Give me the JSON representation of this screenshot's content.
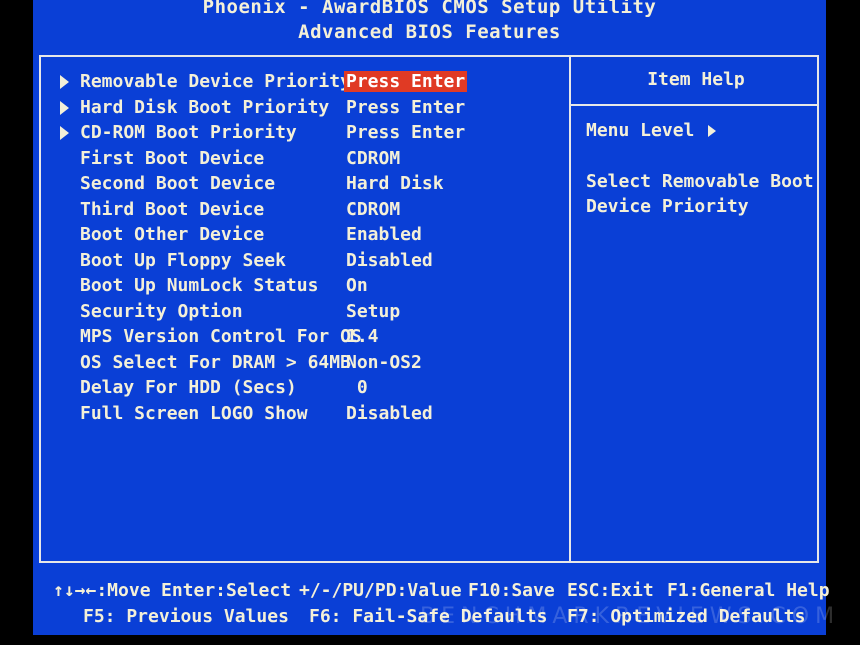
{
  "header": {
    "title": "Phoenix - AwardBIOS CMOS Setup Utility",
    "subtitle": "Advanced BIOS Features"
  },
  "settings": [
    {
      "label": "Removable Device Priority",
      "value": "Press Enter",
      "submenu": true,
      "selected": true
    },
    {
      "label": "Hard Disk Boot Priority",
      "value": "Press Enter",
      "submenu": true,
      "selected": false
    },
    {
      "label": "CD-ROM Boot Priority",
      "value": "Press Enter",
      "submenu": true,
      "selected": false
    },
    {
      "label": "First Boot Device",
      "value": "CDROM",
      "submenu": false,
      "selected": false
    },
    {
      "label": "Second Boot Device",
      "value": "Hard Disk",
      "submenu": false,
      "selected": false
    },
    {
      "label": "Third Boot Device",
      "value": "CDROM",
      "submenu": false,
      "selected": false
    },
    {
      "label": "Boot Other Device",
      "value": "Enabled",
      "submenu": false,
      "selected": false
    },
    {
      "label": "Boot Up Floppy Seek",
      "value": "Disabled",
      "submenu": false,
      "selected": false
    },
    {
      "label": "Boot Up NumLock Status",
      "value": "On",
      "submenu": false,
      "selected": false
    },
    {
      "label": "Security Option",
      "value": "Setup",
      "submenu": false,
      "selected": false
    },
    {
      "label": "MPS Version Control For OS",
      "value": "1.4",
      "submenu": false,
      "selected": false
    },
    {
      "label": "OS Select For DRAM > 64MB",
      "value": "Non-OS2",
      "submenu": false,
      "selected": false
    },
    {
      "label": "Delay For HDD (Secs)",
      "value": " 0",
      "submenu": false,
      "selected": false
    },
    {
      "label": "Full Screen LOGO Show",
      "value": "Disabled",
      "submenu": false,
      "selected": false
    }
  ],
  "help": {
    "title": "Item Help",
    "menu_level": "Menu Level",
    "description_line1": "Select Removable Boot",
    "description_line2": "Device Priority"
  },
  "footer": {
    "move": "↑↓→←:Move",
    "select": "Enter:Select",
    "value": "+/-/PU/PD:Value",
    "save": "F10:Save",
    "exit": "ESC:Exit",
    "general_help": "F1:General Help",
    "previous_values": "F5: Previous Values",
    "failsafe": "F6: Fail-Safe Defaults",
    "optimized": "F7: Optimized Defaults"
  },
  "watermark": "BENCHMARKREVIEWS.COM",
  "colors": {
    "background": "#0a3fd6",
    "text": "#f4f0d8",
    "highlight": "#e03a24"
  }
}
